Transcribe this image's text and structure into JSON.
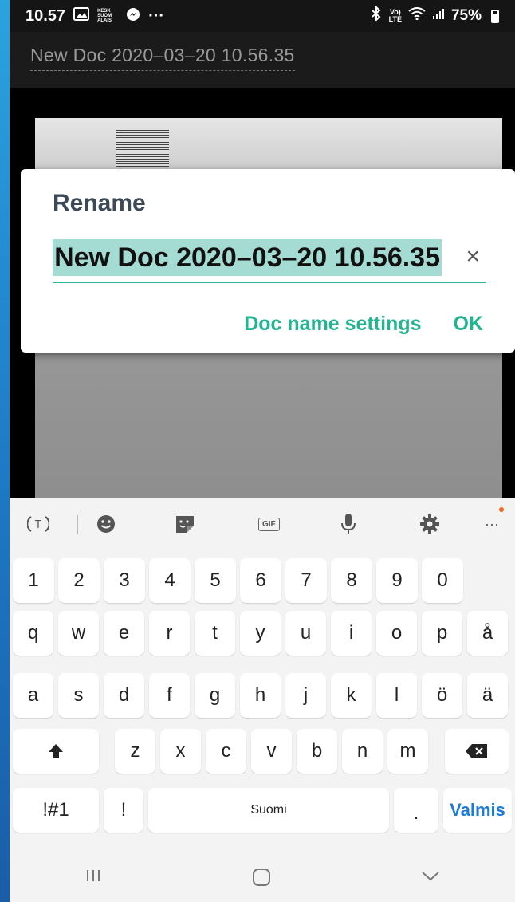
{
  "status_bar": {
    "time": "10.57",
    "news_icon_text": [
      "KESK",
      "SUOM",
      "ALAIS"
    ],
    "overflow": "···",
    "battery": "75%"
  },
  "app_bar": {
    "document_title": "New Doc 2020–03–20 10.56.35"
  },
  "rename_dialog": {
    "title": "Rename",
    "input_value": "New Doc 2020–03–20 10.56.35",
    "clear_symbol": "×",
    "settings_label": "Doc name settings",
    "ok_label": "OK"
  },
  "keyboard": {
    "number_row": [
      "1",
      "2",
      "3",
      "4",
      "5",
      "6",
      "7",
      "8",
      "9",
      "0"
    ],
    "row1": [
      "q",
      "w",
      "e",
      "r",
      "t",
      "y",
      "u",
      "i",
      "o",
      "p",
      "å"
    ],
    "row2": [
      "a",
      "s",
      "d",
      "f",
      "g",
      "h",
      "j",
      "k",
      "l",
      "ö",
      "ä"
    ],
    "row3": [
      "z",
      "x",
      "c",
      "v",
      "b",
      "n",
      "m"
    ],
    "symbols_label": "!#1",
    "exclaim_label": "!",
    "space_label": "Suomi",
    "period_label": ".",
    "action_label": "Valmis",
    "gif_label": "GIF"
  },
  "colors": {
    "accent": "#23b592",
    "selection": "#a4dcd3",
    "action_key": "#1f7ad6"
  }
}
